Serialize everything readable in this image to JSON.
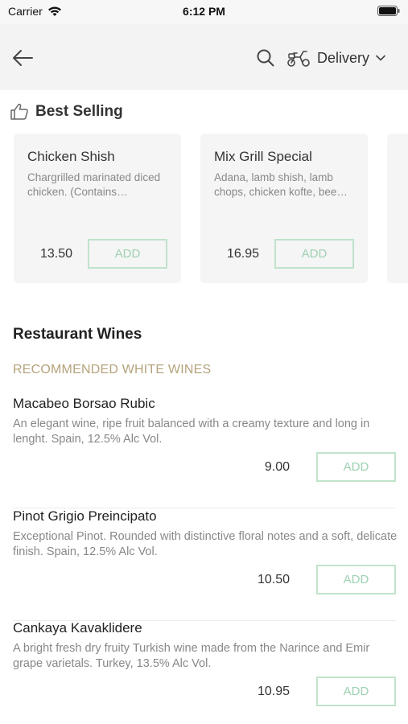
{
  "status_bar": {
    "carrier": "Carrier",
    "time": "6:12 PM"
  },
  "header": {
    "delivery_label": "Delivery"
  },
  "best_selling": {
    "title": "Best Selling",
    "items": [
      {
        "name": "Chicken Shish",
        "description": "Chargrilled marinated diced chicken. (Contains…",
        "price": "13.50",
        "add_label": "ADD"
      },
      {
        "name": "Mix Grill Special",
        "description": "Adana, lamb shish, lamb chops, chicken kofte, bee…",
        "price": "16.95",
        "add_label": "ADD"
      }
    ]
  },
  "menu_section": {
    "title": "Restaurant Wines",
    "subsection": "RECOMMENDED WHITE WINES",
    "items": [
      {
        "name": "Macabeo Borsao Rubic",
        "description": "An elegant wine, ripe fruit balanced with a creamy texture and long in lenght. Spain, 12.5% Alc Vol.",
        "price": "9.00",
        "add_label": "ADD"
      },
      {
        "name": "Pinot Grigio Preincipato",
        "description": "Exceptional Pinot. Rounded with distinctive floral notes and a soft, delicate finish. Spain, 12.5% Alc Vol.",
        "price": "10.50",
        "add_label": "ADD"
      },
      {
        "name": "Cankaya Kavaklidere",
        "description": "A bright fresh dry fruity Turkish wine made from the Narince and Emir grape varietals. Turkey, 13.5% Alc Vol.",
        "price": "10.95",
        "add_label": "ADD"
      }
    ]
  },
  "colors": {
    "accent_green": "#9ed1b2",
    "subsection_gold": "#b5a37c",
    "card_bg": "#f5f5f5"
  },
  "icons": [
    "back-arrow-icon",
    "search-icon",
    "scooter-icon",
    "chevron-down-icon",
    "thumbs-up-icon",
    "wifi-icon",
    "battery-icon"
  ]
}
